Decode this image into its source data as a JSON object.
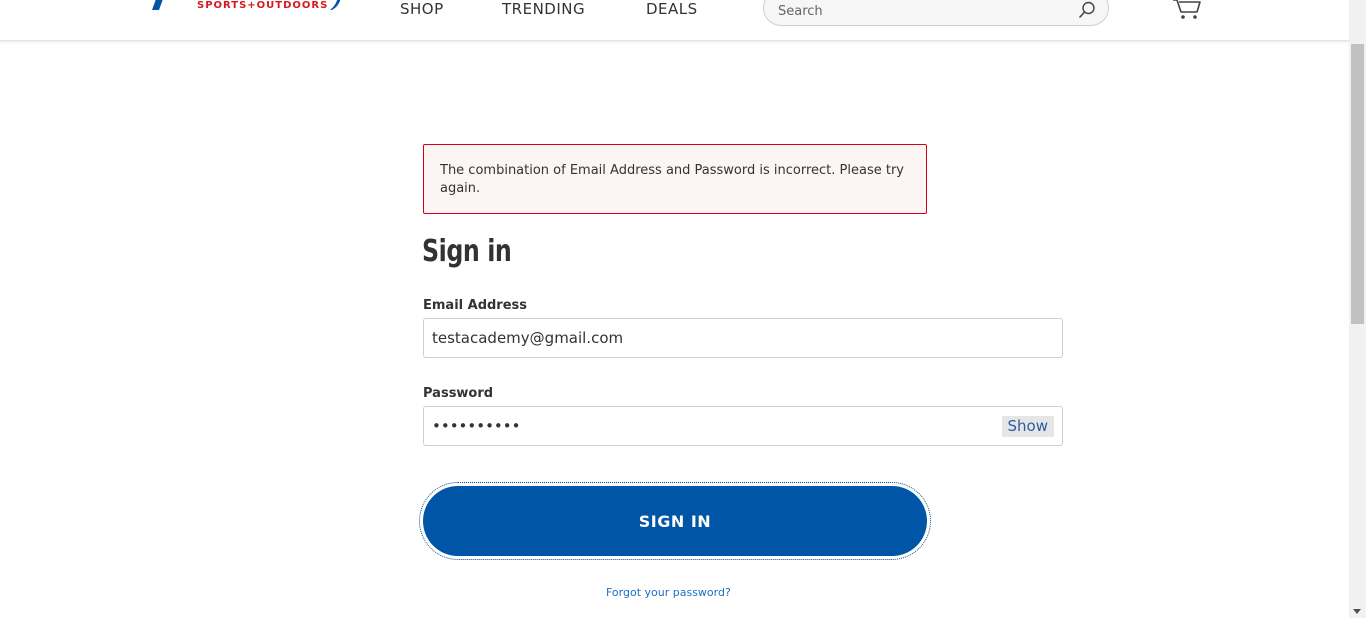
{
  "header": {
    "logo_subtext": "SPORTS+OUTDOORS",
    "nav": [
      "SHOP",
      "TRENDING",
      "DEALS"
    ],
    "search_placeholder": "Search",
    "icons": {
      "search": "search-icon",
      "cart": "cart-icon"
    }
  },
  "form": {
    "error_message": "The combination of Email Address and Password is incorrect. Please try again.",
    "title": "Sign in",
    "email_label": "Email Address",
    "email_value": "testacademy@gmail.com",
    "password_label": "Password",
    "password_value": "••••••••••",
    "show_label": "Show",
    "submit_label": "SIGN IN",
    "forgot_link": "Forgot your password?"
  },
  "colors": {
    "brand_blue": "#0055a6",
    "brand_red": "#d71920",
    "error_border": "#d0021b",
    "error_bg": "#fdf4f4",
    "link": "#1b6fc2"
  }
}
